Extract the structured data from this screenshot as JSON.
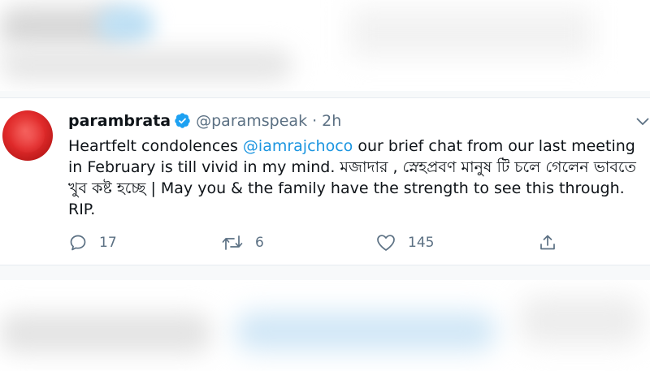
{
  "tweet": {
    "display_name": "parambrata",
    "handle": "@paramspeak",
    "separator": "·",
    "time": "2h",
    "text": {
      "part1": "Heartfelt condolences ",
      "mention": "@iamrajchoco",
      "part2": " our brief chat from our last meeting in February is till vivid in my mind. মজাদার , স্নেহপ্রবণ মানুষ টি চলে গেলেন ভাবতে খুব কষ্ট হচ্ছে | May you & the family have the strength to see this through. RIP."
    },
    "actions": {
      "replies": "17",
      "retweets": "6",
      "likes": "145"
    },
    "icons": [
      "verified-badge-icon",
      "chevron-down-icon",
      "reply-icon",
      "retweet-icon",
      "like-icon",
      "share-icon"
    ]
  },
  "colors": {
    "accent": "#1b95e0",
    "text_primary": "#0f1419",
    "text_secondary": "#5b7083",
    "avatar": "#e02a2a"
  }
}
